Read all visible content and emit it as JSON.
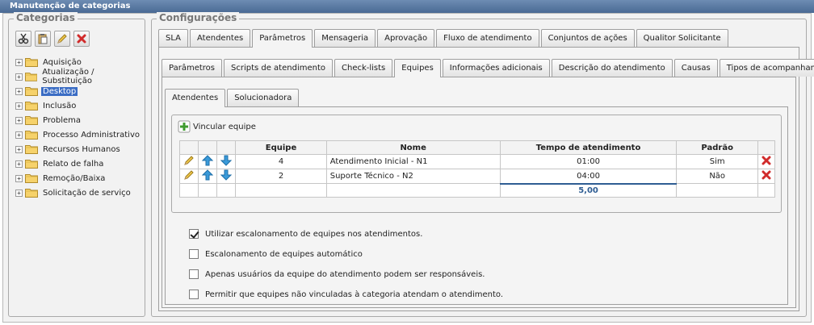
{
  "window": {
    "title": "Manutenção de categorias"
  },
  "categories": {
    "legend": "Categorias",
    "toolbar": [
      {
        "name": "cut-icon"
      },
      {
        "name": "paste-icon"
      },
      {
        "name": "edit-icon"
      },
      {
        "name": "delete-icon"
      }
    ],
    "items": [
      {
        "label": "Aquisição",
        "selected": false
      },
      {
        "label": "Atualização / Substituição",
        "selected": false
      },
      {
        "label": "Desktop",
        "selected": true
      },
      {
        "label": "Inclusão",
        "selected": false
      },
      {
        "label": "Problema",
        "selected": false
      },
      {
        "label": "Processo Administrativo",
        "selected": false
      },
      {
        "label": "Recursos Humanos",
        "selected": false
      },
      {
        "label": "Relato de falha",
        "selected": false
      },
      {
        "label": "Remoção/Baixa",
        "selected": false
      },
      {
        "label": "Solicitação de serviço",
        "selected": false
      }
    ]
  },
  "config": {
    "legend": "Configurações",
    "tabs1": [
      "SLA",
      "Atendentes",
      "Parâmetros",
      "Mensageria",
      "Aprovação",
      "Fluxo de atendimento",
      "Conjuntos de ações",
      "Qualitor Solicitante"
    ],
    "tabs1_active": 2,
    "tabs2": [
      "Parâmetros",
      "Scripts de atendimento",
      "Check-lists",
      "Equipes",
      "Informações adicionais",
      "Descrição do atendimento",
      "Causas",
      "Tipos de acompanhamento"
    ],
    "tabs2_active": 3,
    "tabs3": [
      "Atendentes",
      "Solucionadora"
    ],
    "tabs3_active": 0,
    "link_team": "Vincular equipe",
    "table": {
      "headers": [
        "Equipe",
        "Nome",
        "Tempo de atendimento",
        "Padrão"
      ],
      "rows": [
        {
          "equipe": "4",
          "nome": "Atendimento Inicial - N1",
          "tempo": "01:00",
          "padrao": "Sim"
        },
        {
          "equipe": "2",
          "nome": "Suporte Técnico - N2",
          "tempo": "04:00",
          "padrao": "Não"
        }
      ],
      "total": "5,00"
    },
    "options": [
      {
        "label": "Utilizar escalonamento de equipes nos atendimentos.",
        "checked": true
      },
      {
        "label": "Escalonamento de equipes automático",
        "checked": false
      },
      {
        "label": "Apenas usuários da equipe do atendimento podem ser responsáveis.",
        "checked": false
      },
      {
        "label": "Permitir que equipes não vinculadas à categoria atendam o atendimento.",
        "checked": false
      }
    ]
  }
}
